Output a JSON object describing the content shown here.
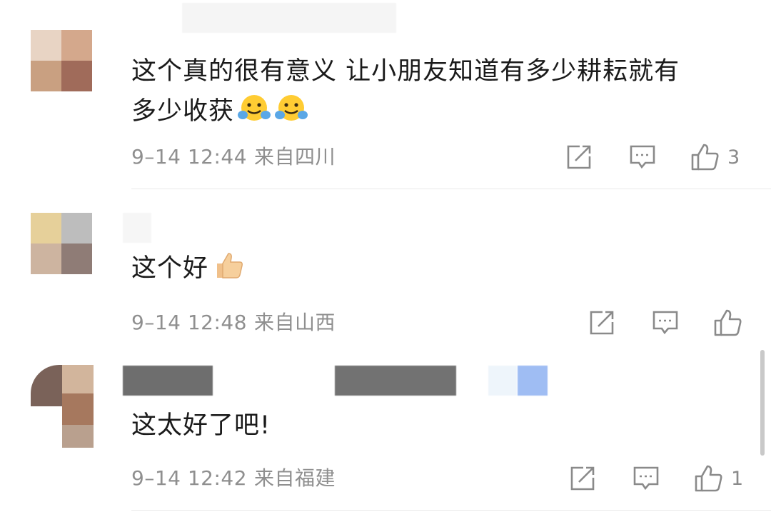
{
  "comments": [
    {
      "text_line1": "这个真的很有意义  让小朋友知道有多少耕耘就有",
      "text_line2": "多少收获",
      "emoji_icons": [
        "hugging-face-icon",
        "hugging-face-icon"
      ],
      "date": "9–14 12:44",
      "location": "来自四川",
      "like_count": "3"
    },
    {
      "text": "这个好",
      "emoji_icons": [
        "thumbs-up-icon"
      ],
      "date": "9–14 12:48",
      "location": "来自山西",
      "like_count": ""
    },
    {
      "text": "这太好了吧!",
      "date": "9–14 12:42",
      "location": "来自福建",
      "like_count": "1"
    }
  ],
  "icons": [
    "share-icon",
    "reply-icon",
    "like-icon"
  ],
  "colors": {
    "text": "#1a1a1a",
    "meta": "#8f8f8f",
    "icon": "#8a8a8a",
    "divider": "#e9e9e9"
  }
}
